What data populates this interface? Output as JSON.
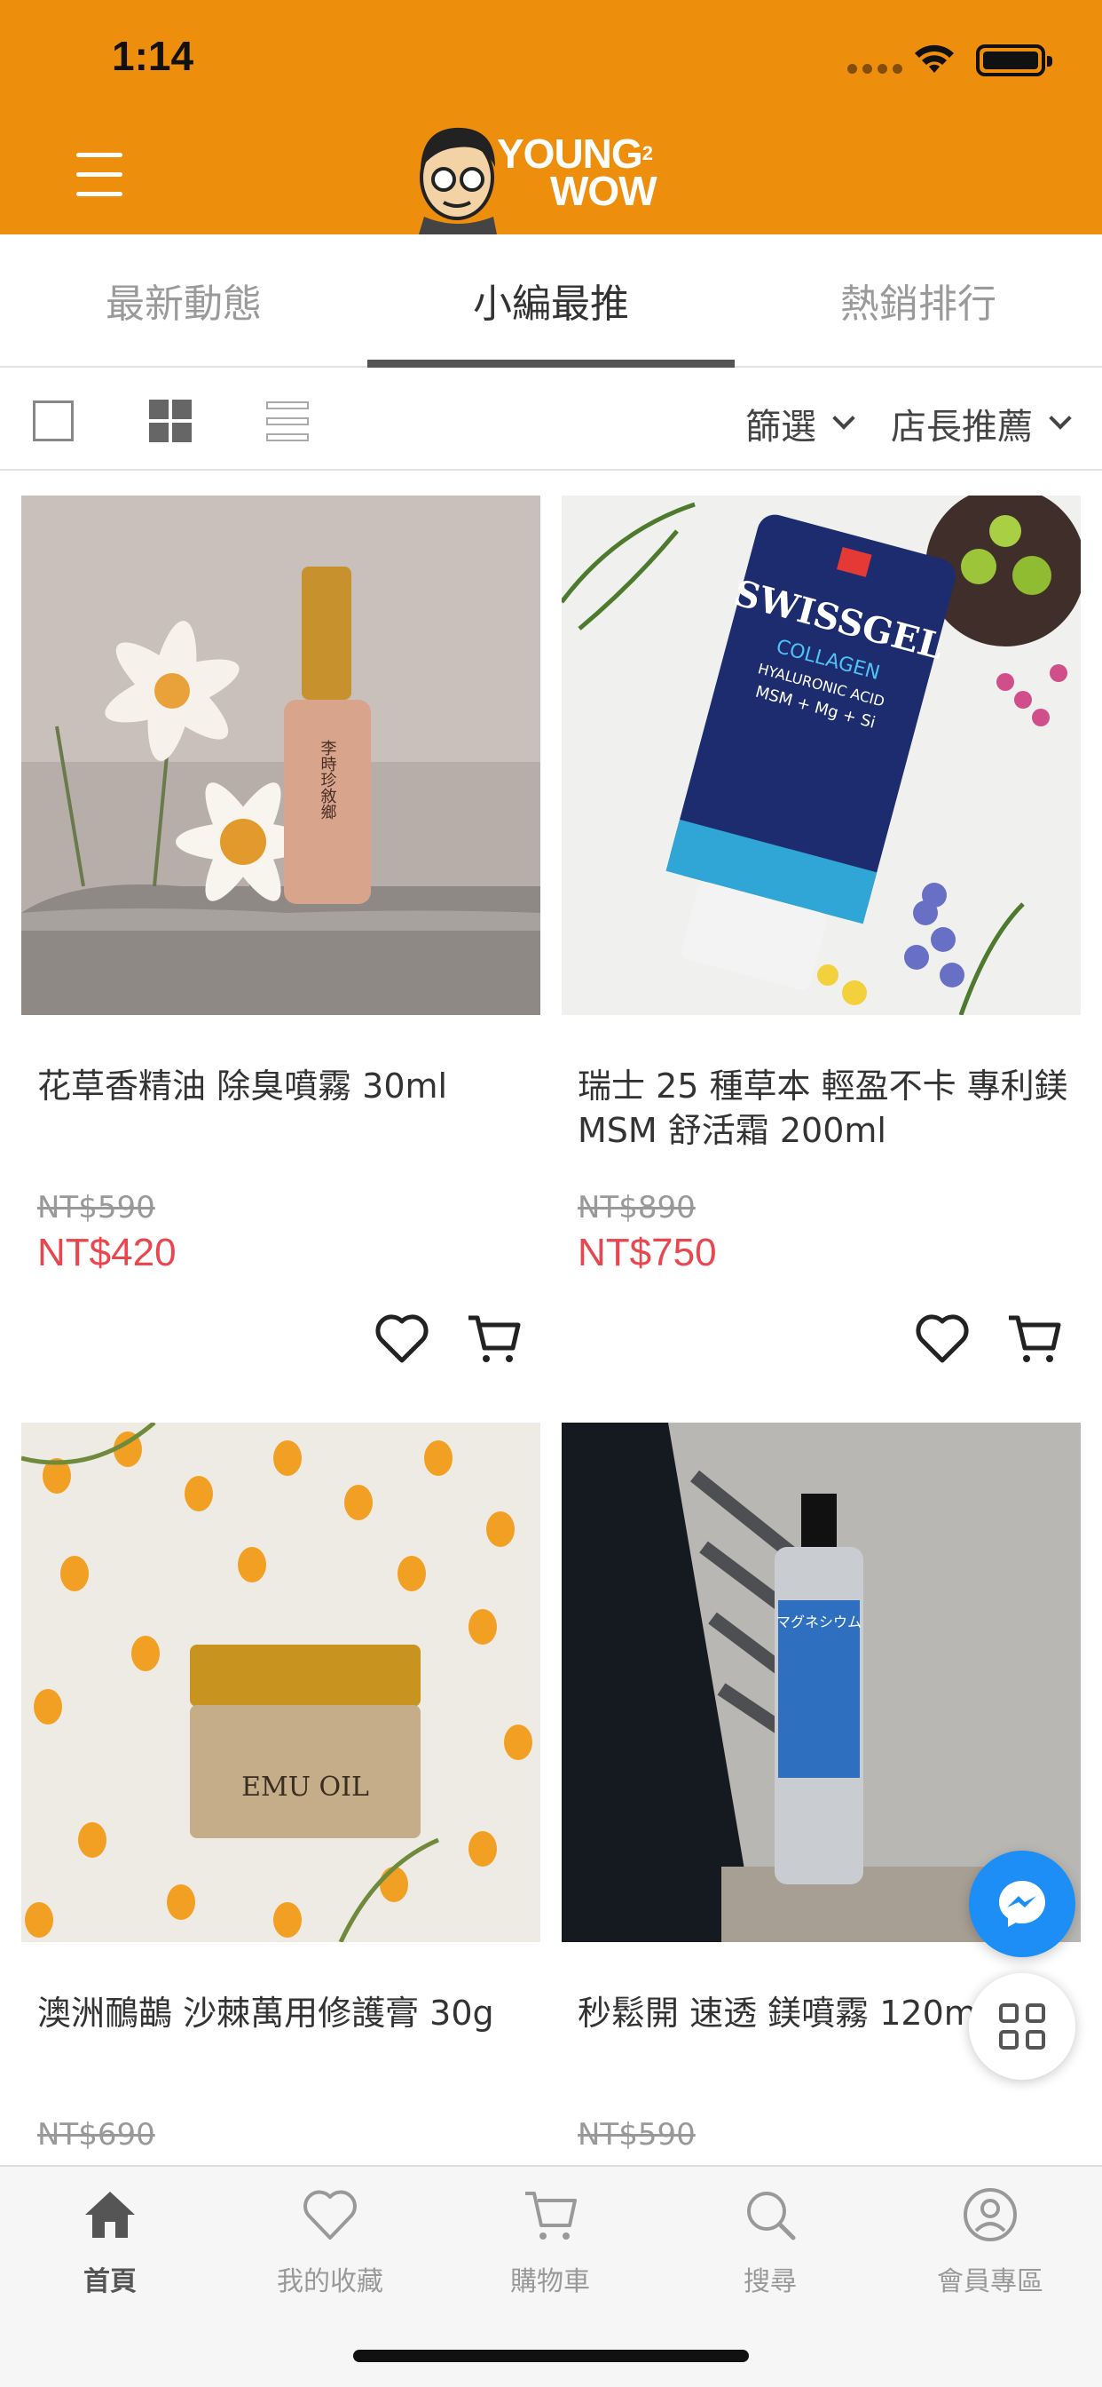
{
  "status_bar": {
    "time": "1:14"
  },
  "header": {
    "logo_text_1": "YOUNG",
    "logo_text_2": "WOW",
    "logo_small": "2"
  },
  "tabs": [
    {
      "label": "最新動態",
      "active": false
    },
    {
      "label": "小編最推",
      "active": true
    },
    {
      "label": "熱銷排行",
      "active": false
    }
  ],
  "toolbar": {
    "filter_label": "篩選",
    "sort_label": "店長推薦"
  },
  "products": [
    {
      "name": "花草香精油 除臭噴霧 30ml",
      "old_price": "NT$590",
      "price": "NT$420"
    },
    {
      "name": "瑞士 25 種草本 輕盈不卡 專利鎂 MSM 舒活霜 200ml",
      "old_price": "NT$890",
      "price": "NT$750"
    },
    {
      "name": "澳洲鴯鶓 沙棘萬用修護膏 30g",
      "old_price": "NT$690"
    },
    {
      "name": "秒鬆開 速透 鎂噴霧 120ml",
      "old_price": "NT$590"
    }
  ],
  "product_image_text": {
    "swissgel_brand": "SWISSGEL",
    "swissgel_line1": "COLLAGEN",
    "swissgel_line2": "HYALURONIC ACID",
    "swissgel_line3": "MSM + Mg + Si",
    "emu_label": "EMU OIL",
    "bottle_label": "李時珍敘鄉"
  },
  "bottom_nav": [
    {
      "label": "首頁",
      "icon": "home-icon",
      "active": true
    },
    {
      "label": "我的收藏",
      "icon": "heart-icon",
      "active": false
    },
    {
      "label": "購物車",
      "icon": "cart-icon",
      "active": false
    },
    {
      "label": "搜尋",
      "icon": "search-icon",
      "active": false
    },
    {
      "label": "會員專區",
      "icon": "user-icon",
      "active": false
    }
  ],
  "colors": {
    "brand_orange": "#EE8E0D",
    "price_red": "#E8474F",
    "messenger_blue": "#1C8EF5"
  }
}
